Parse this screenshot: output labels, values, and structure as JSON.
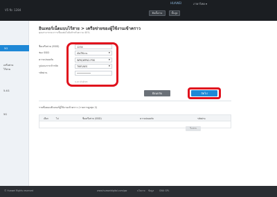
{
  "topbar": {
    "brand": "V5 fb: 1284",
    "center_label": "HUAWEI",
    "language_label": "ภาษาไทย ▾",
    "btn_primary": "ติดตั้งง่าย",
    "btn_secondary": "ขั้นสูง"
  },
  "sidebar": {
    "active_item": "5G",
    "items": [
      "เครือข่าย",
      "ไร้สาย",
      "5.4G",
      "5G"
    ]
  },
  "main": {
    "title": "อินเทอร์เน็ตแบบไร้สาย > เครือข่ายของผู้ใช้งานเข้าคราว",
    "subtitle": "คุณสามารถจะการเชื่อมต่อไปยังสำหรับความ 40%"
  },
  "form": {
    "ssid_label": "ชื่อเครือข่าย (SSID)",
    "ssid_value": "1234",
    "band_label": "ช่อง SSID",
    "band_value": "เปิดใช้งาน",
    "security_label": "ความปลอดภัย",
    "security_value": "WPA/WPA2-PSK",
    "encryption_label": "รูปแบบการเข้ารหัส",
    "encryption_value": "TKIP/AES",
    "password_label": "รหัสผ่าน",
    "password_value": "••••••••••",
    "hint": "0-63 ตัวอักษร"
  },
  "actions": {
    "back_label": "ย้อนกลับ",
    "next_label": "ถัดไป"
  },
  "table": {
    "title": "รายชื่อคอมพิวเตอร์ผู้ใช้งานเข้าคราว (รายการสูงสุด 2)",
    "columns": [
      "เลือก",
      "ไม่",
      "ชื่อเครือข่าย (SSID)",
      "ความปลอดภัย",
      "รหัสผ่าน"
    ],
    "refresh_label": "รีเฟรช"
  },
  "footer": {
    "copyright": "© Huawei Rights reserved",
    "links": [
      "www.huaweidigital.com/gw",
      "นโยบาย",
      "ข้อมูล",
      "GNU GPL"
    ]
  }
}
